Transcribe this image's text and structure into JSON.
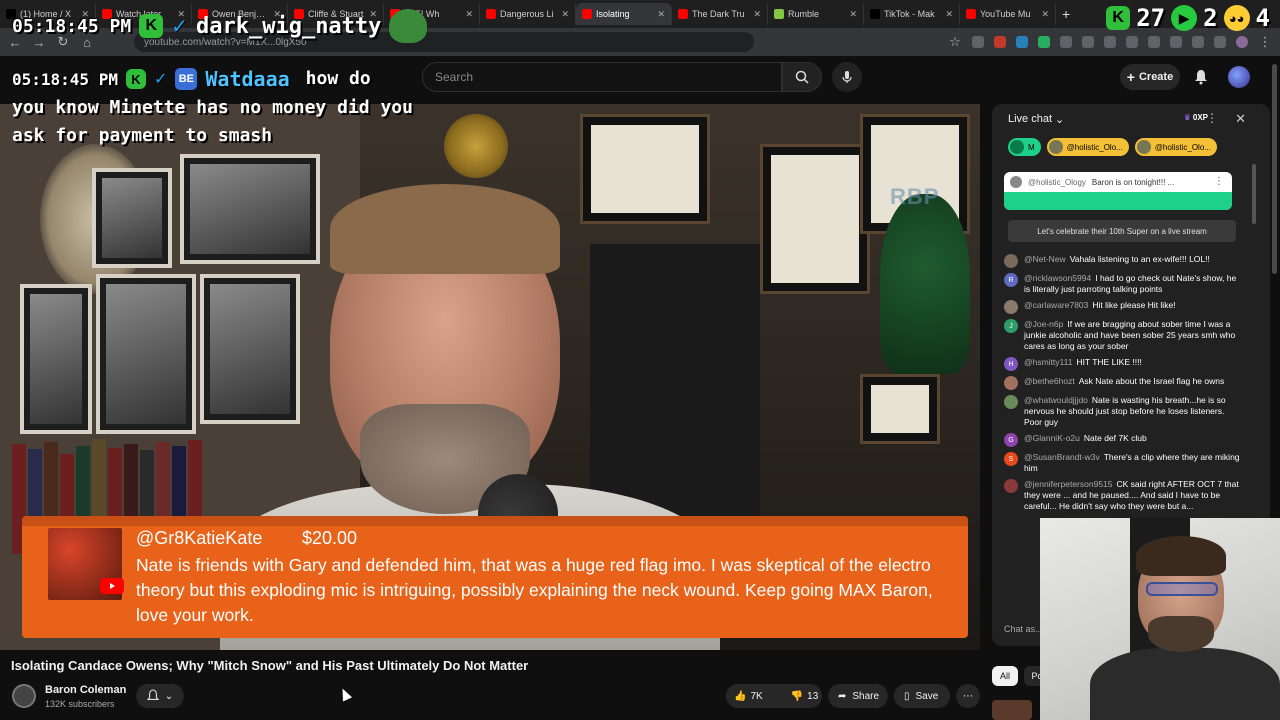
{
  "browser": {
    "tabs": [
      {
        "label": "(1) Home / X",
        "color": "#000000",
        "active": false
      },
      {
        "label": "Watch later",
        "color": "#ff0000",
        "active": false
      },
      {
        "label": "Owen Benjamin",
        "color": "#ff0000",
        "active": false
      },
      {
        "label": "Cliffe & Stuart",
        "color": "#ff0000",
        "active": false
      },
      {
        "label": "ATE! Wh",
        "color": "#ff0000",
        "active": false
      },
      {
        "label": "Dangerous Li",
        "color": "#ff0000",
        "active": false
      },
      {
        "label": "Isolating",
        "color": "#ff0000",
        "active": true
      },
      {
        "label": "The Dark Tru",
        "color": "#ff0000",
        "active": false
      },
      {
        "label": "Rumble",
        "color": "#85c742",
        "active": false
      },
      {
        "label": "TikTok - Mak",
        "color": "#000000",
        "active": false
      },
      {
        "label": "YouTube Mu",
        "color": "#ff0000",
        "active": false
      }
    ],
    "url": "youtube.com/watch?v=M1X...0lgX50"
  },
  "overlay": {
    "time_top": "05:18:45 PM",
    "user_top": "dark_wig_natty",
    "right_num1": "27",
    "right_num2": "2",
    "right_num3": "4",
    "time_msg": "05:18:45 PM",
    "user_msg": "Watdaaa",
    "msg_first": "how do",
    "msg_rest": "you know Minette has no money did you ask for payment to smash"
  },
  "youtube": {
    "search_placeholder": "Search",
    "create_label": "Create"
  },
  "superchat": {
    "user": "@Gr8KatieKate",
    "amount": "$20.00",
    "body": "Nate is friends with Gary and defended him, that was a huge red flag imo. I was skeptical of the electro theory but this exploding mic is intriguing, possibly explaining the neck wound. Keep going MAX Baron, love your work."
  },
  "video": {
    "title": "Isolating Candace Owens; Why \"Mitch Snow\" and His Past Ultimately Do Not Matter",
    "channel": "Baron Coleman",
    "subscribers": "132K subscribers",
    "likes": "7K",
    "dislikes": "13",
    "share_label": "Share",
    "save_label": "Save",
    "watermark": "RBP"
  },
  "chat": {
    "title": "Live chat",
    "points": "0XP",
    "chips": [
      {
        "label": "M",
        "style": "green"
      },
      {
        "label": "@holistic_Olo...",
        "style": "gold"
      },
      {
        "label": "@holistic_Olo...",
        "style": "gold"
      }
    ],
    "pinned_user": "@holistic_Ology",
    "pinned_text": "Baron is on tonight!!! ...",
    "celebrate": "Let's celebrate their 10th Super on a live stream",
    "messages": [
      {
        "user": "@Net-New",
        "text": "Vahala listening to an ex-wife!!! LOL!!",
        "color": "#7a6a5a",
        "initial": ""
      },
      {
        "user": "@ricklawson5994",
        "text": "I had to go check out Nate's show, he is literally just parroting talking points",
        "color": "#5c6bc0",
        "initial": "R"
      },
      {
        "user": "@carlaware7803",
        "text": "Hit like please Hit like!",
        "color": "#8a7a6a",
        "initial": ""
      },
      {
        "user": "@Joe-n6p",
        "text": "If we are bragging about sober time I was a junkie alcoholic and have been sober 25 years smh who cares as long as your sober",
        "color": "#2e9d6a",
        "initial": "J"
      },
      {
        "user": "@hsmitty111",
        "text": "HIT THE LIKE !!!!",
        "color": "#7e57c2",
        "initial": "H"
      },
      {
        "user": "@bethe6hozt",
        "text": "Ask Nate about the Israel flag he owns",
        "color": "#a07060",
        "initial": ""
      },
      {
        "user": "@whatwouldjjjdo",
        "text": "Nate is wasting his breath...he is so nervous he should just stop before he loses listeners. Poor guy",
        "color": "#6a8a5a",
        "initial": ""
      },
      {
        "user": "@GlanniK-o2u",
        "text": "Nate def 7K club",
        "color": "#8e44ad",
        "initial": "G"
      },
      {
        "user": "@SusanBrandt-w3v",
        "text": "There's a clip where they are miking him",
        "color": "#e64a19",
        "initial": "S"
      },
      {
        "user": "@jenniferpeterson9515",
        "text": "CK said right AFTER OCT 7 that they were ... and he paused.... And said I have to be careful... He didn't say who they were but a...",
        "color": "#8a3a3a",
        "initial": ""
      }
    ],
    "input_placeholder": "Chat as..."
  },
  "filters": {
    "all": "All",
    "second": "Po"
  }
}
